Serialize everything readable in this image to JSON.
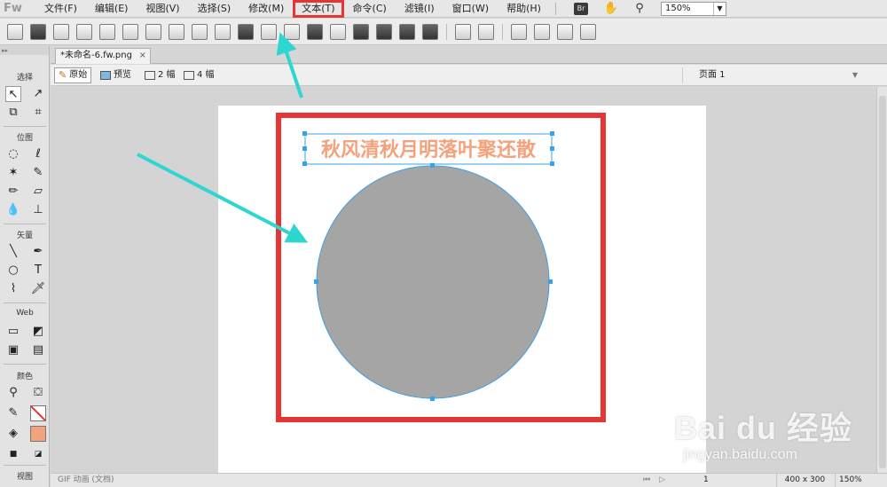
{
  "app": {
    "logo": "Fw"
  },
  "menubar": {
    "items": [
      "文件(F)",
      "编辑(E)",
      "视图(V)",
      "选择(S)",
      "修改(M)",
      "文本(T)",
      "命令(C)",
      "滤镜(I)",
      "窗口(W)",
      "帮助(H)"
    ],
    "highlighted": "文本(T)",
    "bridge_label": "Br",
    "zoom": "150%"
  },
  "document": {
    "tab_name": "*未命名-6.fw.png",
    "close": "×"
  },
  "viewbar": {
    "original": "原始",
    "preview": "预览",
    "two_up": "2 幅",
    "four_up": "4 幅",
    "page": "页面 1"
  },
  "tools": {
    "select": "选择",
    "bitmap": "位图",
    "vector": "矢量",
    "web": "Web",
    "colors": "颜色",
    "view": "视图"
  },
  "canvas": {
    "text_object": "秋风清秋月明落叶聚还散",
    "text_color": "#f4a27c",
    "circle_fill": "#a5a5a5",
    "selection_color": "#3aa0e8",
    "annotation_color": "#e63535",
    "arrow_color": "#2ed6d0"
  },
  "statusbar": {
    "left_text": "GIF 动画 (文档)",
    "frame": "1",
    "size": "400 x 300",
    "zoom": "150%"
  },
  "watermark": {
    "brand": "Bai du 经验",
    "url": "jingyan.baidu.com"
  }
}
